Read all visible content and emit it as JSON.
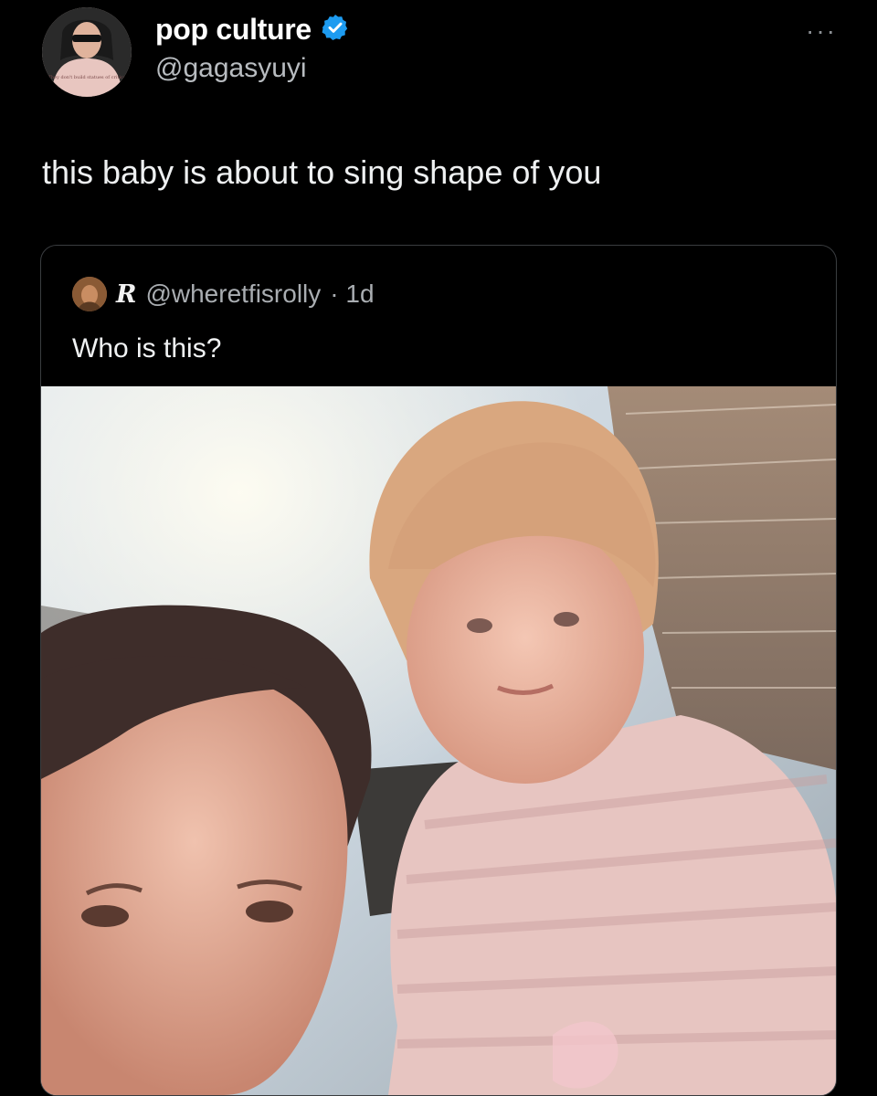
{
  "tweet": {
    "display_name": "pop culture",
    "handle": "@gagasyuyi",
    "verified": true,
    "more_label": "···",
    "text": "this baby is about to sing shape of you",
    "avatar_shirt_text": "They don't build statues of critics"
  },
  "quoted_tweet": {
    "display_name": "R",
    "handle": "@wheretfisrolly",
    "time": "· 1d",
    "text": "Who is this?"
  },
  "colors": {
    "background": "#000000",
    "verified_badge": "#1d9bf0",
    "text_primary": "#e7e9ea",
    "text_secondary": "#a9adb1",
    "border": "#3a3d40"
  }
}
